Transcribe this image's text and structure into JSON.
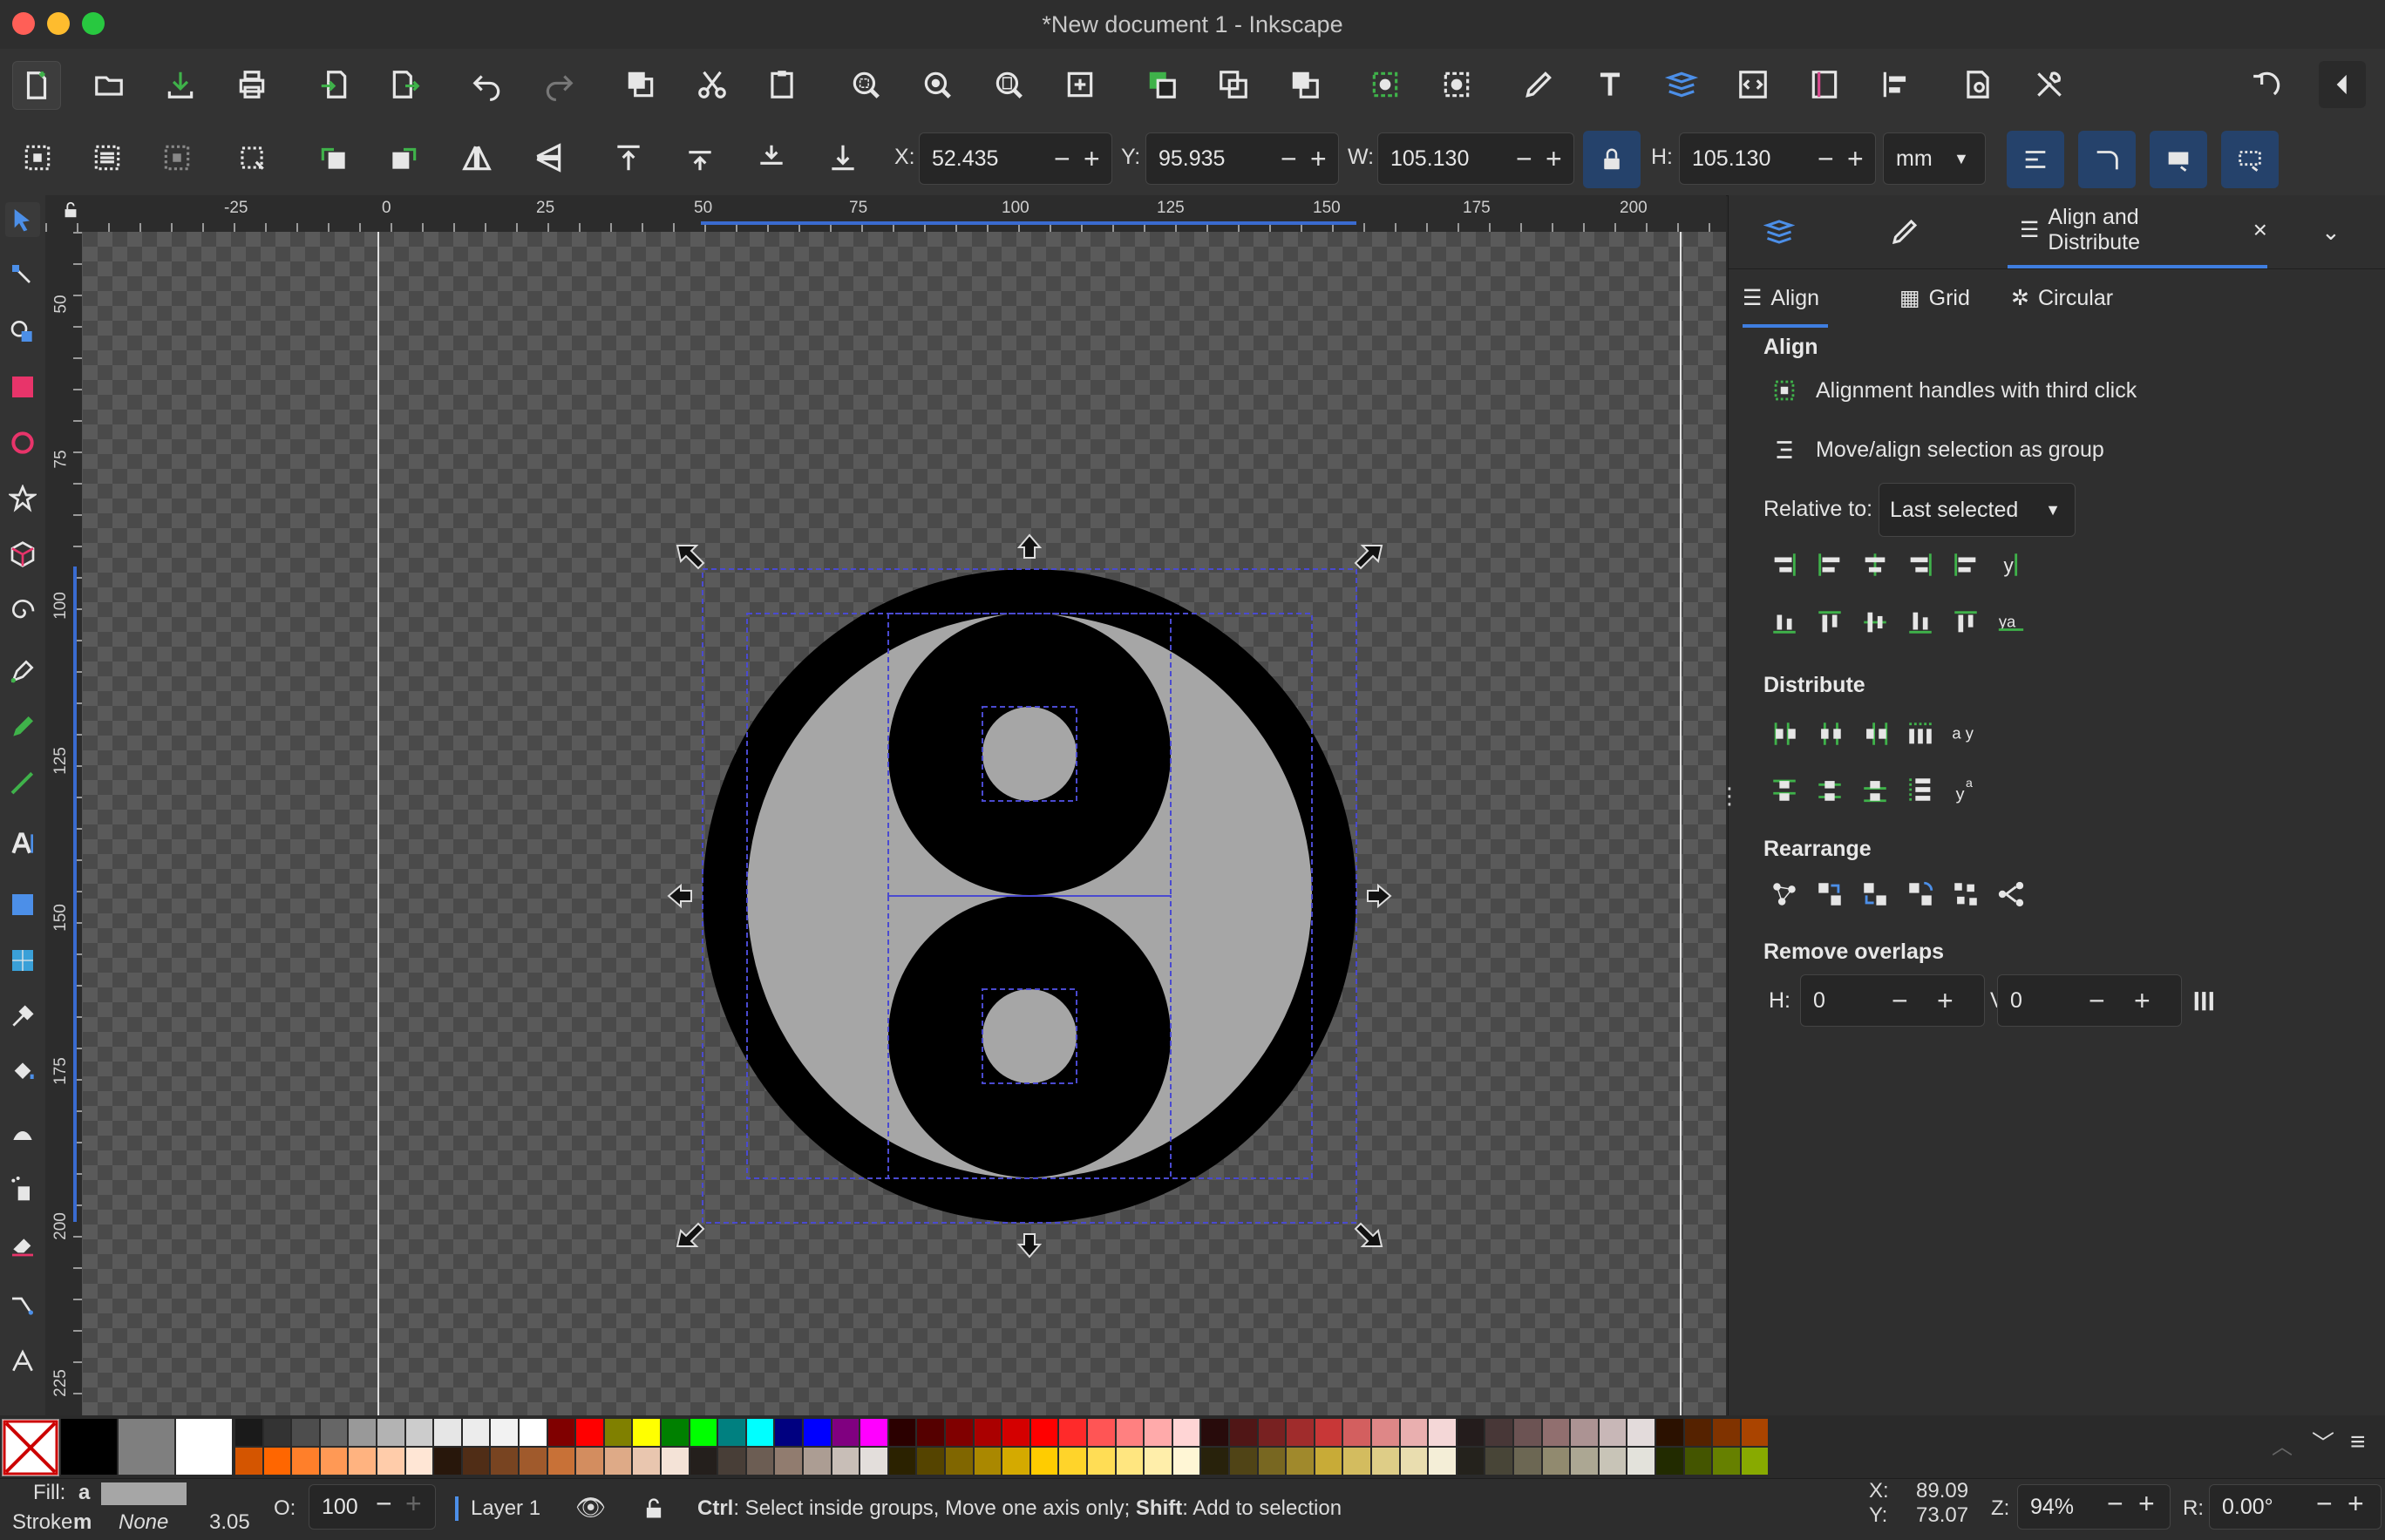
{
  "window": {
    "title": "*New document 1 - Inkscape"
  },
  "command_bar": {
    "icons": [
      "new-document-icon",
      "open-icon",
      "save-icon",
      "print-icon",
      "import-icon",
      "export-icon",
      "undo-icon",
      "redo-icon",
      "copy-icon",
      "cut-icon",
      "paste-icon",
      "zoom-selection-icon",
      "zoom-drawing-icon",
      "zoom-page-icon",
      "zoom-center-icon",
      "duplicate-icon",
      "clone-icon",
      "unlink-clone-icon",
      "group-icon",
      "ungroup-icon",
      "fill-stroke-icon",
      "text-font-icon",
      "layers-icon",
      "xml-editor-icon",
      "object-properties-icon",
      "align-icon",
      "document-properties-icon",
      "preferences-icon",
      "snap-toggle-icon",
      "collapse-icon"
    ]
  },
  "controls": {
    "x_label": "X:",
    "x_value": "52.435",
    "y_label": "Y:",
    "y_value": "95.935",
    "w_label": "W:",
    "w_value": "105.130",
    "h_label": "H:",
    "h_value": "105.130",
    "unit": "mm"
  },
  "rulers": {
    "horizontal": [
      "-25",
      "0",
      "25",
      "50",
      "75",
      "100",
      "125",
      "150",
      "175",
      "200"
    ],
    "vertical": [
      "50",
      "75",
      "100",
      "125",
      "150",
      "175",
      "200",
      "225"
    ]
  },
  "dock": {
    "active_tab": "Align and Distribute",
    "subtabs": [
      "Align",
      "Grid",
      "Circular"
    ],
    "align_heading": "Align",
    "opt_handles": "Alignment handles with third click",
    "opt_group": "Move/align selection as group",
    "relative_label": "Relative to:",
    "relative_value": "Last selected",
    "distribute_heading": "Distribute",
    "rearrange_heading": "Rearrange",
    "overlaps_heading": "Remove overlaps",
    "overlap_h_label": "H:",
    "overlap_h_value": "0",
    "overlap_v_label": "V:",
    "overlap_v_value": "0"
  },
  "status": {
    "fill_label": "Fill:",
    "fill_value": "a",
    "stroke_label": "Stroke:",
    "stroke_value": "m",
    "stroke_none": "None",
    "stroke_width": "3.05",
    "opacity_label": "O:",
    "opacity_value": "100",
    "layer": "Layer 1",
    "message_ctrl": "Ctrl",
    "message_1": ": Select inside groups, Move one axis only; ",
    "message_shift": "Shift",
    "message_2": ": Add to selection",
    "cursor_x_label": "X:",
    "cursor_x": "89.09",
    "cursor_y_label": "Y:",
    "cursor_y": "73.07",
    "zoom_label": "Z:",
    "zoom": "94%",
    "rotation_label": "R:",
    "rotation": "0.00°"
  },
  "colors": {
    "accent": "#25426b",
    "selection_dash": "#4a4ad0",
    "palette_top": [
      "#000000",
      "#7f7f7f",
      "#ffffff",
      "#1a1a1a",
      "#333333",
      "#4d4d4d",
      "#666666",
      "#999999",
      "#b3b3b3",
      "#cccccc",
      "#e6e6e6",
      "#ececec",
      "#f2f2f2",
      "#ffffff",
      "#800000",
      "#ff0000",
      "#808000",
      "#ffff00",
      "#008000",
      "#00ff00",
      "#008080",
      "#00ffff",
      "#000080",
      "#0000ff",
      "#800080",
      "#ff00ff",
      "#2b0000",
      "#550000",
      "#800000",
      "#aa0000",
      "#d40000",
      "#ff0000",
      "#ff2a2a",
      "#ff5555",
      "#ff8080",
      "#ffaaaa",
      "#ffd5d5",
      "#280b0b",
      "#501616",
      "#782121",
      "#a02c2c",
      "#c83737",
      "#d35f5f",
      "#de8787",
      "#e9afaf",
      "#f4d7d7",
      "#241c1c",
      "#483737",
      "#6c5353",
      "#916f6f",
      "#ac9393",
      "#c8b7b7",
      "#e3dbdb",
      "#2b1100",
      "#552200",
      "#803300",
      "#aa4400"
    ],
    "palette_bottom": [
      "#d45500",
      "#ff6600",
      "#ff7f2a",
      "#ff9955",
      "#ffb380",
      "#ffccaa",
      "#ffe6d5",
      "#28170b",
      "#502d16",
      "#784421",
      "#a05a2c",
      "#c87137",
      "#d38d5f",
      "#deaa87",
      "#e9c6af",
      "#f4e3d7",
      "#241f1c",
      "#483e37",
      "#6c5d53",
      "#917c6f",
      "#ac9d93",
      "#c8beb7",
      "#e3dedb",
      "#2b2200",
      "#554400",
      "#806600",
      "#aa8800",
      "#d4aa00",
      "#ffcc00",
      "#ffd42a",
      "#ffdd55",
      "#ffe680",
      "#ffeeaa",
      "#fff6d5",
      "#28220b",
      "#504416",
      "#786721",
      "#a0892c",
      "#c8ab37",
      "#d3bc5f",
      "#decd87",
      "#e9ddaf",
      "#f4eed7",
      "#24221c",
      "#484537",
      "#6c6753",
      "#918a6f",
      "#aca793",
      "#c8c4b7",
      "#e3e2db",
      "#222b00",
      "#445500",
      "#668000",
      "#88aa00"
    ]
  }
}
